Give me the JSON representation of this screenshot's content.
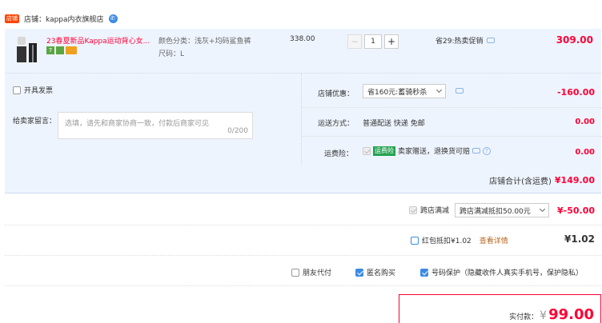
{
  "shop": {
    "badge": "店铺",
    "label": "店铺：",
    "name": "kappa内衣旗舰店"
  },
  "item": {
    "title": "23春夏新品Kappa运动背心女...",
    "spec_color": "颜色分类：浅灰+均码鲨鱼裤",
    "spec_size": "尺码：L",
    "unit_price": "338.00",
    "quantity": "1",
    "promo": "省29:热卖促销",
    "subtotal": "309.00"
  },
  "invoice": {
    "label": "开具发票"
  },
  "message": {
    "label": "给卖家留言：",
    "placeholder": "选填，请先和商家协商一致，付款后商家可见",
    "counter": "0/200"
  },
  "discount": {
    "label": "店铺优惠：",
    "selected": "省160元:蓄骑秒杀",
    "amount": "-160.00"
  },
  "shipping": {
    "label": "运送方式：",
    "method": "普通配送 快递 免邮",
    "amount": "0.00"
  },
  "insurance": {
    "label": "运费险：",
    "tag": "运费险",
    "desc": "卖家赠送，退换货可赔",
    "amount": "0.00"
  },
  "shop_total": {
    "label": "店铺合计(含运费)",
    "amount": "¥149.00"
  },
  "cross_store": {
    "label": "跨店满减",
    "selected": "跨店满减抵扣50.00元",
    "amount": "¥-50.00"
  },
  "red_packet": {
    "label": "红包抵扣¥1.02",
    "link": "查看详情",
    "amount": "¥1.02"
  },
  "options": {
    "friend_pay": "朋友代付",
    "anonymous": "匿名购买",
    "privacy": "号码保护（隐藏收件人真实手机号，保护隐私）"
  },
  "payment": {
    "label": "实付款：",
    "currency": "¥",
    "amount": "99.00"
  },
  "colors": {
    "accent_red": "#ff0036",
    "row_bg": "#eef4fd",
    "check_blue": "#3c8be6",
    "link_orange": "#b8651e"
  }
}
